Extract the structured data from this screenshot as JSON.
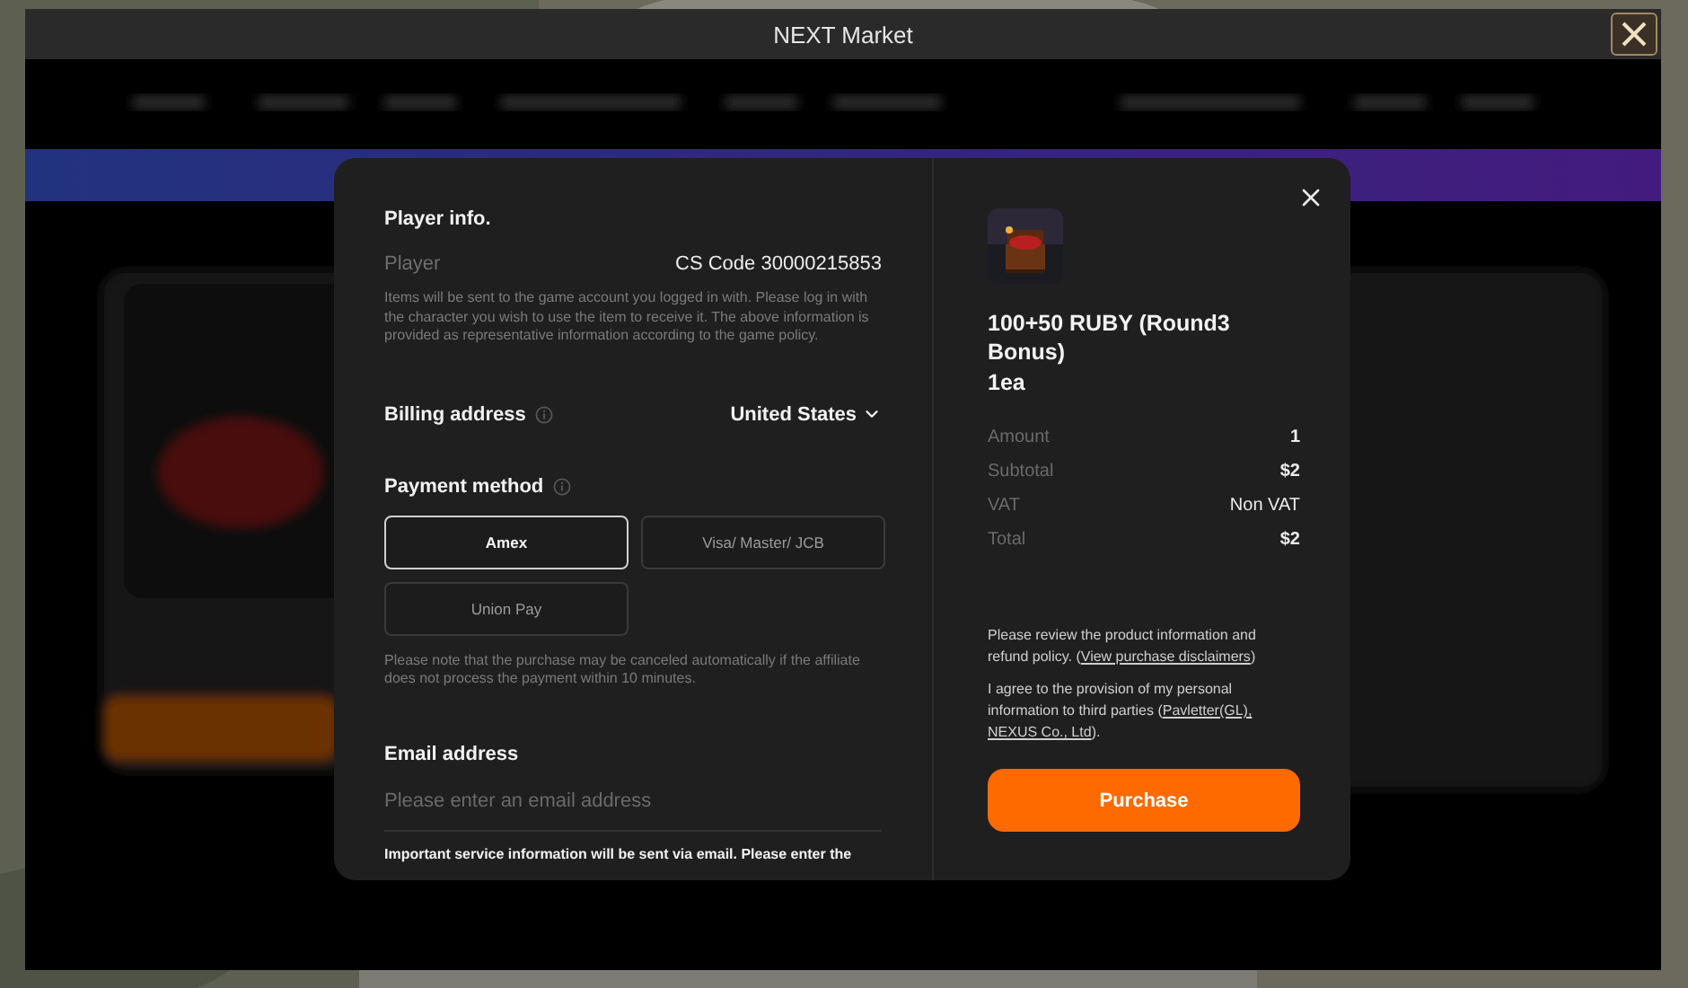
{
  "window": {
    "title": "NEXT Market"
  },
  "player_info": {
    "heading": "Player info.",
    "label": "Player",
    "value": "CS Code 30000215853",
    "note": "Items will be sent to the game account you logged in with. Please log in with the character you wish to use the item to receive it. The above information is provided as representative information according to the game policy."
  },
  "billing": {
    "label": "Billing address",
    "value": "United States"
  },
  "payment": {
    "label": "Payment method",
    "methods": [
      {
        "label": "Amex",
        "selected": true
      },
      {
        "label": "Visa/ Master/ JCB",
        "selected": false
      },
      {
        "label": "Union Pay",
        "selected": false
      }
    ],
    "note": "Please note that the purchase may be canceled automatically if the affiliate does not process the payment within 10 minutes."
  },
  "email": {
    "label": "Email address",
    "placeholder": "Please enter an email address",
    "note": "Important service information will be sent via email. Please enter the"
  },
  "summary": {
    "product_title": "100+50 RUBY (Round3 Bonus)",
    "quantity": "1ea",
    "rows": [
      {
        "label": "Amount",
        "value": "1"
      },
      {
        "label": "Subtotal",
        "value": "$2"
      },
      {
        "label": "VAT",
        "value": "Non VAT"
      },
      {
        "label": "Total",
        "value": "$2"
      }
    ],
    "notices": [
      [
        {
          "kind": "text",
          "text": "Please review the product information and refund policy. ("
        },
        {
          "kind": "link",
          "text": "View purchase disclaimers"
        },
        {
          "kind": "text",
          "text": ")"
        }
      ],
      [
        {
          "kind": "text",
          "text": "I agree to the provision of my personal information to third parties ("
        },
        {
          "kind": "link",
          "text": "Pavletter(GL),"
        },
        {
          "kind": "link",
          "text": "NEXUS Co., Ltd"
        },
        {
          "kind": "text",
          "text": ")."
        }
      ]
    ],
    "purchase_button": "Purchase"
  }
}
